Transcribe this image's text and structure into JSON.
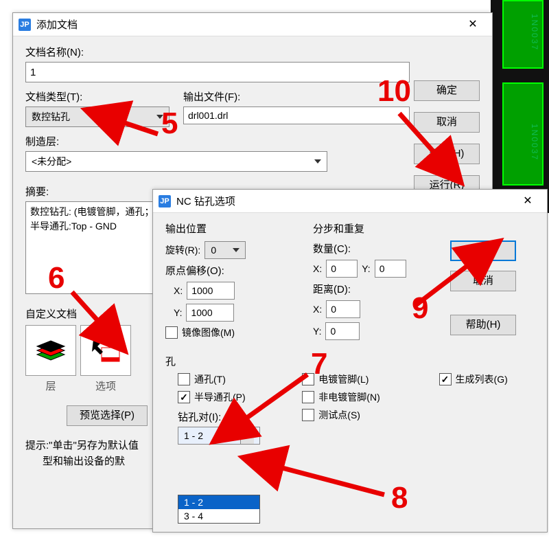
{
  "bg": {
    "text": "1N0037"
  },
  "dialog1": {
    "title": "添加文档",
    "name_label": "文档名称(N):",
    "name_value": "1",
    "type_label": "文档类型(T):",
    "type_value": "数控钻孔",
    "outfile_label": "输出文件(F):",
    "outfile_value": "drl001.drl",
    "layer_label": "制造层:",
    "layer_value": "<未分配>",
    "summary_label": "摘要:",
    "summary_lines": [
      "数控钻孔: (电镀管脚，通孔；",
      "半导通孔:Top - GND"
    ],
    "custom_label": "自定义文档",
    "layers_cap": "层",
    "options_cap": "选项",
    "preview_btn": "预览选择(P)",
    "hint1": "提示:\"单击\"另存为默认值",
    "hint2": "型和输出设备的默",
    "ok": "确定",
    "cancel": "取消",
    "help": "帮助(H)",
    "run": "运行(R)"
  },
  "dialog2": {
    "title": "NC 钻孔选项",
    "out_pos": "输出位置",
    "step_repeat": "分步和重复",
    "rotate_label": "旋转(R):",
    "rotate_value": "0",
    "origin_label": "原点偏移(O):",
    "x_label": "X:",
    "y_label": "Y:",
    "origin_x": "1000",
    "origin_y": "1000",
    "mirror_label": "镜像图像(M)",
    "count_label": "数量(C):",
    "count_x": "0",
    "count_y": "0",
    "dist_label": "距离(D):",
    "dist_x": "0",
    "dist_y": "0",
    "holes_label": "孔",
    "chk_through": "通孔(T)",
    "chk_partial": "半导通孔(P)",
    "chk_plated": "电镀管脚(L)",
    "chk_nonplated": "非电镀管脚(N)",
    "chk_testpt": "测试点(S)",
    "drillpair_label": "钻孔对(I):",
    "drillpair_sel": "1 - 2",
    "drillpair_opts": [
      "1 - 2",
      "3 - 4"
    ],
    "gen_list": "生成列表(G)",
    "ok": "确定",
    "cancel": "取消",
    "help": "帮助(H)"
  },
  "annotations": {
    "n5": "5",
    "n6": "6",
    "n7": "7",
    "n8": "8",
    "n9": "9",
    "n10": "10"
  }
}
